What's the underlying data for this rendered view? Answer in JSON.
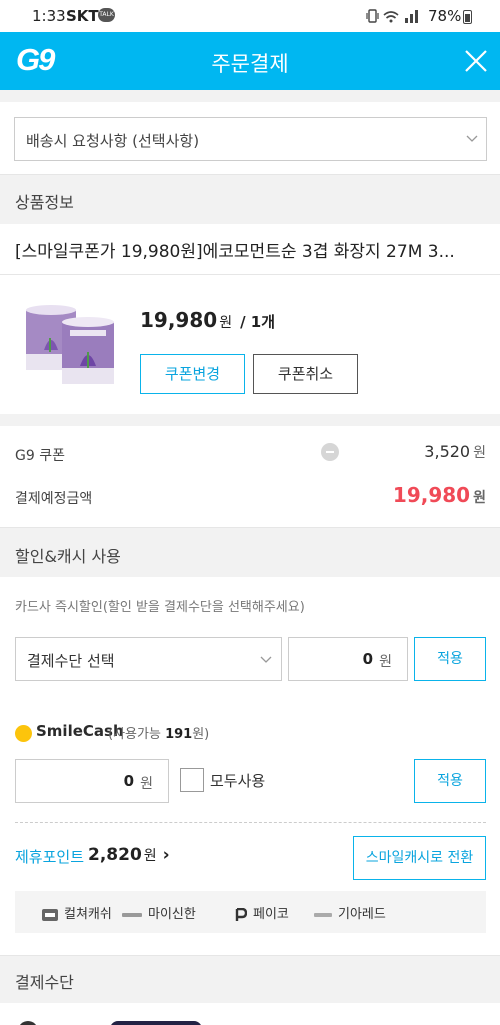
{
  "status_bar": {
    "time": "1:33",
    "carrier": "SKT",
    "talk_badge": "TALK",
    "battery": "78%"
  },
  "header": {
    "logo": "G9",
    "title": "주문결제",
    "close_icon": "close-icon"
  },
  "delivery_request": {
    "placeholder": "배송시 요청사항 (선택사항)"
  },
  "product_section": {
    "title": "상품정보",
    "name": "[스마일쿠폰가 19,980원]에코모먼트순 3겹 화장지 27M 3...",
    "price": "19,980",
    "price_unit": "원",
    "quantity": "/ 1개",
    "coupon_change_label": "쿠폰변경",
    "coupon_cancel_label": "쿠폰취소"
  },
  "summary": {
    "coupon_label": "G9 쿠폰",
    "coupon_value": "3,520",
    "coupon_unit": "원",
    "expected_label": "결제예정금액",
    "expected_value": "19,980",
    "expected_unit": "원"
  },
  "discount_section": {
    "title": "할인&캐시 사용",
    "card_hint": "카드사 즉시할인(할인 받을 결제수단을 선택해주세요)",
    "payment_select_label": "결제수단 선택",
    "amount_value": "0",
    "amount_unit": "원",
    "apply_label": "적용",
    "smilecash_brand": "SmileCash",
    "smilecash_available_prefix": "(사용가능",
    "smilecash_available_amount": "191",
    "smilecash_available_suffix": "원)",
    "cash_amount": "0",
    "cash_unit": "원",
    "use_all_label": "모두사용",
    "cash_apply_label": "적용",
    "point_label": "제휴포인트",
    "point_value": "2,820",
    "point_unit": "원",
    "point_arrow": "›",
    "convert_label": "스마일캐시로 전환",
    "partners": [
      "컬쳐캐쉬",
      "마이신한",
      "페이코",
      "기아레드"
    ],
    "partner_icons": [
      "culture-cash-icon",
      "shinhan-icon",
      "payco-icon",
      "kia-red-icon"
    ]
  },
  "payment_section": {
    "title": "결제수단"
  },
  "colors": {
    "brand": "#00b7f1",
    "accent_blue": "#0aa4de",
    "price_red": "#f04a57"
  }
}
